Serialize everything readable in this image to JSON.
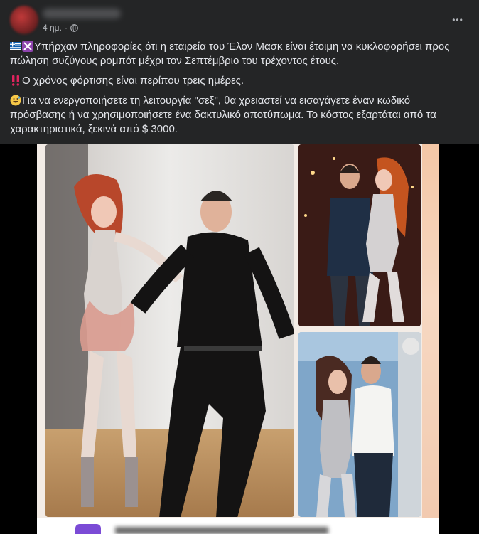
{
  "post": {
    "time": "4 ημ.",
    "separator": "·",
    "privacy_icon": "globe-icon",
    "more_icon": "more-horizontal-icon",
    "more_label": "•••"
  },
  "caption": {
    "line1_text": "Υπήρχαν πληροφορίες ότι η εταιρεία του Έλον Μασκ είναι έτοιμη να κυκλοφορήσει προς πώληση συζύγους ρομπότ μέχρι τον Σεπτέμβριο του τρέχοντος έτους.",
    "line2_text": "Ο χρόνος φόρτισης είναι περίπου τρεις ημέρες.",
    "line3_text": "Για να ενεργοποιήσετε τη λειτουργία \"σεξ\", θα χρειαστεί να εισαγάγετε έναν κωδικό πρόσβασης ή να χρησιμοποιήσετε ένα δακτυλικό αποτύπωμα. Το κόστος εξαρτάται από τα χαρακτηριστικά, ξεκινά από $ 3000.",
    "line1_icons": [
      "greek-flag-icon",
      "crossed-swords-icon"
    ],
    "line2_icon": "double-exclamation-icon",
    "line3_icon": "grinning-sweat-face-icon"
  },
  "media": {
    "images": [
      "collage-main-image",
      "collage-top-right-image",
      "collage-bottom-right-image"
    ],
    "colors": {
      "bg": "#000000",
      "collage_bg": "#f3ece6",
      "accent": "#7b4bd6"
    }
  }
}
